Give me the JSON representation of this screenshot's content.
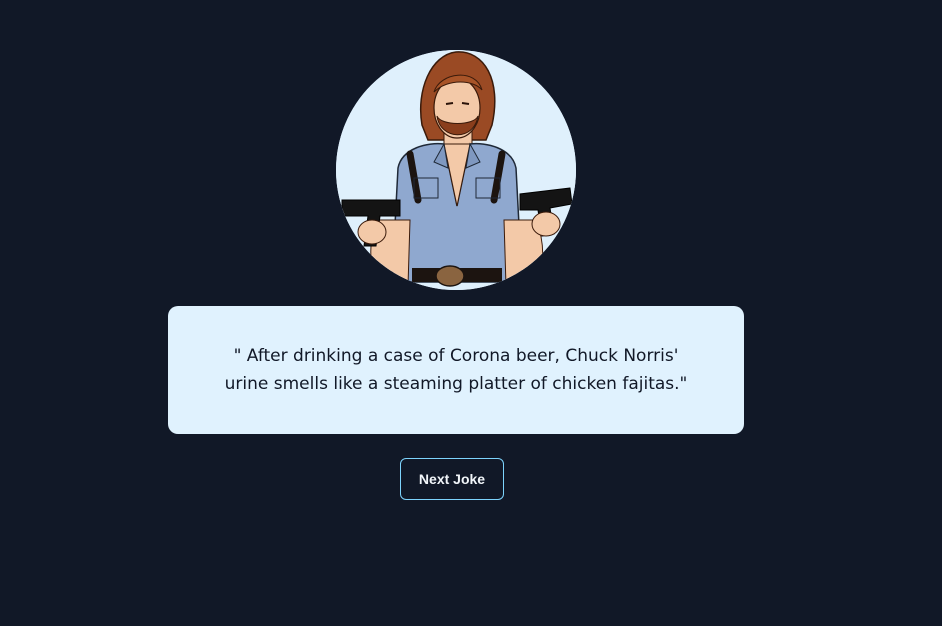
{
  "avatar": {
    "icon": "chuck-norris-illustration"
  },
  "joke": {
    "text": "\" After drinking a case of Corona beer, Chuck Norris' urine smells like a steaming platter of chicken fajitas.\""
  },
  "controls": {
    "next_label": "Next Joke"
  },
  "colors": {
    "background": "#111827",
    "card": "#e0f2fe",
    "button_border": "#7dd3fc"
  }
}
